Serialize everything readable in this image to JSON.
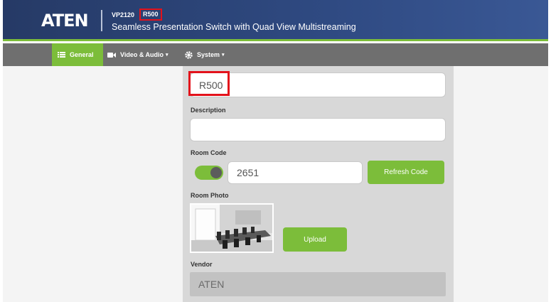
{
  "header": {
    "logo_text": "ATEN",
    "model": "VP2120",
    "device_name": "R500",
    "product_description": "Seamless Presentation Switch with Quad View Multistreaming"
  },
  "nav": {
    "items": [
      {
        "label": "General",
        "icon": "list-icon",
        "active": true
      },
      {
        "label": "Video & Audio",
        "icon": "camera-icon",
        "dropdown": true
      },
      {
        "label": "System",
        "icon": "gear-icon",
        "dropdown": true
      }
    ]
  },
  "form": {
    "name_value": "R500",
    "description_label": "Description",
    "description_value": "",
    "room_code_label": "Room Code",
    "room_code_enabled": true,
    "room_code_value": "2651",
    "refresh_code_label": "Refresh Code",
    "room_photo_label": "Room Photo",
    "upload_label": "Upload",
    "vendor_label": "Vendor",
    "vendor_value": "ATEN"
  },
  "colors": {
    "header_bg": "#2f4a82",
    "accent_green": "#7cbd3a",
    "navbar_bg": "#6f6f6f",
    "highlight_red": "#e3121b",
    "panel_bg": "#d8d8d8"
  }
}
